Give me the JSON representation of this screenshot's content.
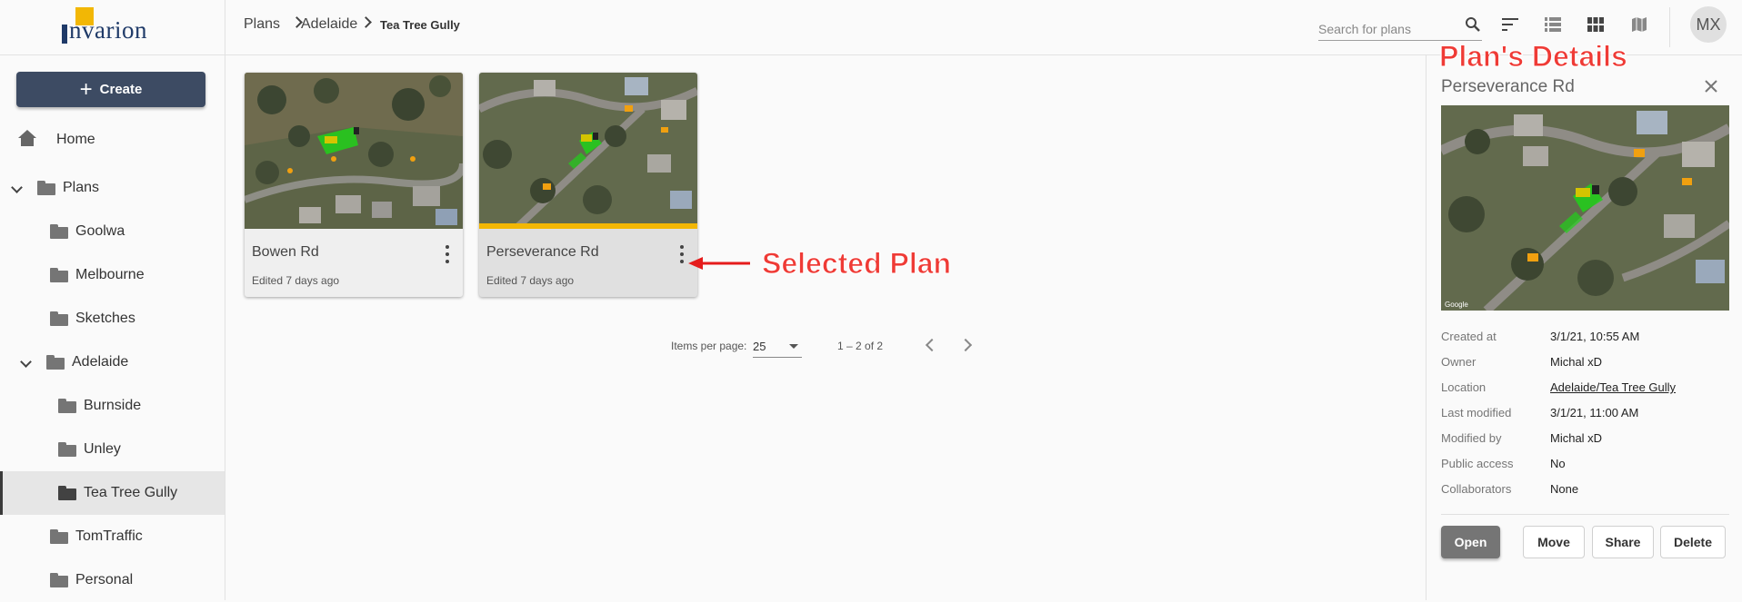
{
  "brand": {
    "name": "nvarion"
  },
  "sidebar": {
    "create_label": "Create",
    "items": [
      {
        "label": "Home"
      },
      {
        "label": "Plans"
      },
      {
        "label": "Goolwa"
      },
      {
        "label": "Melbourne"
      },
      {
        "label": "Sketches"
      },
      {
        "label": "Adelaide"
      },
      {
        "label": "Burnside"
      },
      {
        "label": "Unley"
      },
      {
        "label": "Tea Tree Gully"
      },
      {
        "label": "TomTraffic"
      },
      {
        "label": "Personal"
      }
    ]
  },
  "breadcrumb": [
    "Plans",
    "Adelaide",
    "Tea Tree Gully"
  ],
  "search": {
    "placeholder": "Search for plans"
  },
  "user": {
    "initials": "MX"
  },
  "cards": [
    {
      "title": "Bowen Rd",
      "subtitle": "Edited 7 days ago"
    },
    {
      "title": "Perseverance Rd",
      "subtitle": "Edited 7 days ago"
    }
  ],
  "annotations": {
    "selected": "Selected Plan",
    "details": "Plan's Details"
  },
  "pagination": {
    "items_label": "Items per page:",
    "page_size": "25",
    "range": "1 – 2 of 2"
  },
  "details": {
    "title": "Perseverance Rd",
    "rows": [
      {
        "label": "Created at",
        "value": "3/1/21, 10:55 AM"
      },
      {
        "label": "Owner",
        "value": "Michal xD"
      },
      {
        "label": "Location",
        "value": "Adelaide/Tea Tree Gully"
      },
      {
        "label": "Last modified",
        "value": "3/1/21, 11:00 AM"
      },
      {
        "label": "Modified by",
        "value": "Michal xD"
      },
      {
        "label": "Public access",
        "value": "No"
      },
      {
        "label": "Collaborators",
        "value": "None"
      }
    ],
    "buttons": {
      "open": "Open",
      "move": "Move",
      "share": "Share",
      "delete": "Delete"
    }
  },
  "colors": {
    "accent": "#3d4b63",
    "brand_yellow": "#f2b705",
    "annotation": "#ef3b36"
  }
}
